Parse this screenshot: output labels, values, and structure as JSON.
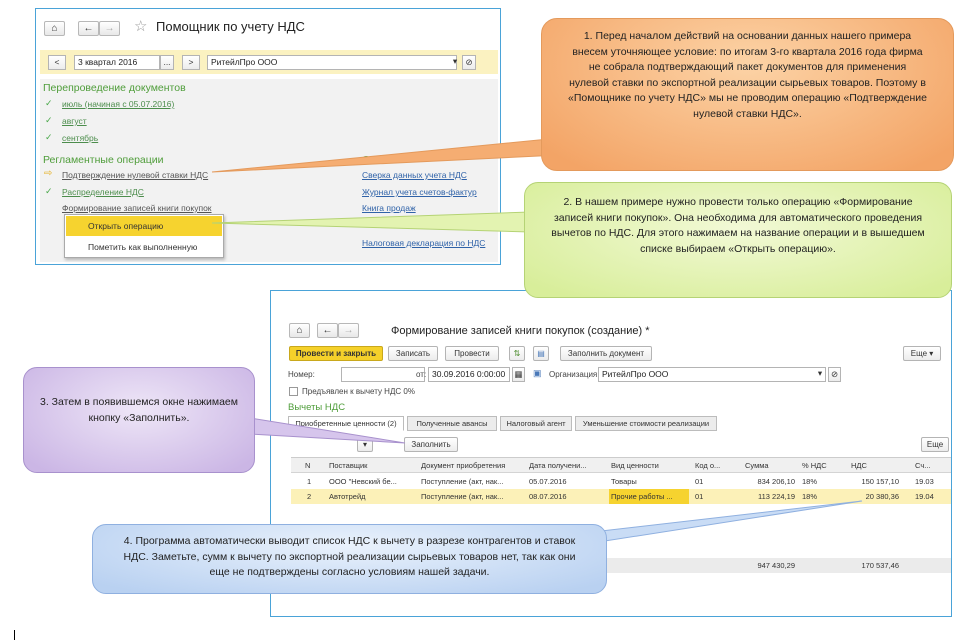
{
  "shot1": {
    "title": "Помощник по учету НДС",
    "nav": {
      "home": "⌂",
      "back": "←",
      "forward": "→",
      "star": "☆"
    },
    "toolbar": {
      "prev": "<",
      "period": "3 квартал 2016",
      "period_btn": "...",
      "next": ">",
      "org": "РитейлПро ООО",
      "org_dd": "▾",
      "org_link": "⊘"
    },
    "reprocessing": {
      "header": "Перепроведение документов",
      "items": [
        "июль (начиная с 05.07.2016)",
        "август",
        "сентябрь"
      ]
    },
    "regulated": {
      "header": "Регламентные операции",
      "items": [
        "Подтверждение нулевой ставки НДС",
        "Распределение НДС",
        "Формирование записей книги покупок"
      ]
    },
    "reports": {
      "header": "Отчеты",
      "items": [
        "Сверка данных учета НДС",
        "Журнал учета счетов-фактур",
        "Книга продаж",
        "Налоговая декларация по НДС"
      ]
    },
    "popup": {
      "open": "Открыть операцию",
      "mark_done": "Пометить как выполненную"
    }
  },
  "shot2": {
    "title": "Формирование записей книги покупок (создание) *",
    "nav": {
      "home": "⌂",
      "back": "←",
      "forward": "→"
    },
    "toolbar": {
      "post_close": "Провести и закрыть",
      "save": "Записать",
      "post": "Провести",
      "fill_doc": "Заполнить документ",
      "more": "Еще ▾"
    },
    "form": {
      "number_label": "Номер:",
      "number_value": "",
      "date_label": "от:",
      "date_value": "30.09.2016  0:00:00",
      "org_label": "Организация:",
      "org_value": "РитейлПро ООО",
      "checkbox_label": "Предъявлен к вычету НДС 0%"
    },
    "section": "Вычеты НДС",
    "tabs": [
      "Приобретенные ценности (2)",
      "Полученные авансы",
      "Налоговый агент",
      "Уменьшение стоимости реализации"
    ],
    "fill_button": "Заполнить",
    "more2": "Еще",
    "columns": [
      "N",
      "Поставщик",
      "Документ приобретения",
      "Дата получени...",
      "Вид ценности",
      "Код о...",
      "Сумма",
      "% НДС",
      "НДС",
      "Сч..."
    ],
    "rows": [
      [
        "1",
        "ООО \"Невский бе...",
        "Поступление (акт, нак...",
        "05.07.2016",
        "Товары",
        "01",
        "834 206,10",
        "18%",
        "150 157,10",
        "19.03"
      ],
      [
        "2",
        "Автотрейд",
        "Поступление (акт, нак...",
        "08.07.2016",
        "Прочие работы ...",
        "01",
        "113 224,19",
        "18%",
        "20 380,36",
        "19.04"
      ]
    ],
    "totals": {
      "sum": "947 430,29",
      "vat": "170 537,46"
    }
  },
  "callouts": {
    "c1": "1. Перед началом действий на основании данных нашего примера внесем уточняющее условие: по итогам 3-го квартала 2016 года фирма не собрала подтверждающий пакет документов для применения нулевой ставки по экспортной реализации сырьевых товаров. Поэтому в «Помощнике по учету НДС» мы не проводим операцию «Подтверждение нулевой ставки НДС».",
    "c2": "2. В нашем примере нужно провести только операцию «Формирование записей книги покупок». Она необходима для автоматического проведения вычетов по НДС. Для этого нажимаем на название операции и в вышедшем списке выбираем «Открыть операцию».",
    "c3": "3. Затем в появившемся окне нажимаем кнопку «Заполнить».",
    "c4": "4. Программа автоматически выводит список НДС к вычету в разрезе контрагентов и ставок НДС. Заметьте, сумм к вычету по экспортной реализации сырьевых товаров нет, так как они еще не подтверждены согласно условиям нашей задачи."
  }
}
